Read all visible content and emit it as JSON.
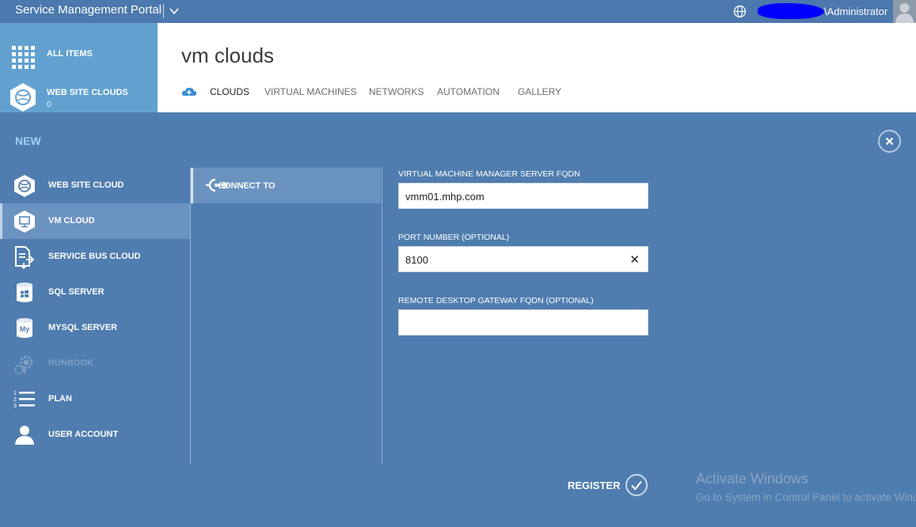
{
  "topbar": {
    "app_title": "Service Management Portal",
    "user": "\\Administrator",
    "icons": [
      "chevron-down-icon",
      "globe-icon",
      "avatar-icon"
    ]
  },
  "nav": {
    "items": [
      {
        "label": "ALL ITEMS",
        "icon": "grid-icon"
      },
      {
        "label": "WEB SITE CLOUDS",
        "count": "0",
        "icon": "web-site-cloud-icon"
      }
    ]
  },
  "header": {
    "title": "vm clouds",
    "tabs": [
      {
        "label": "CLOUDS",
        "active": true
      },
      {
        "label": "VIRTUAL MACHINES"
      },
      {
        "label": "NETWORKS"
      },
      {
        "label": "AUTOMATION"
      },
      {
        "label": "GALLERY"
      }
    ]
  },
  "drawer": {
    "title": "NEW",
    "categories": [
      {
        "label": "WEB SITE CLOUD",
        "icon": "web-site-cloud-icon"
      },
      {
        "label": "VM CLOUD",
        "icon": "monitor-icon",
        "selected": true
      },
      {
        "label": "SERVICE BUS CLOUD",
        "icon": "service-bus-icon"
      },
      {
        "label": "SQL SERVER",
        "icon": "sql-server-icon"
      },
      {
        "label": "MYSQL SERVER",
        "icon": "mysql-icon"
      },
      {
        "label": "RUNBOOK",
        "icon": "gear-icon",
        "disabled": true
      },
      {
        "label": "PLAN",
        "icon": "numbered-list-icon"
      },
      {
        "label": "USER ACCOUNT",
        "icon": "user-icon"
      }
    ],
    "step": {
      "label": "CONNECT TO",
      "icon": "plug-icon"
    },
    "fields": {
      "vmm_label": "VIRTUAL MACHINE MANAGER SERVER FQDN",
      "vmm_value": "vmm01.mhp.com",
      "port_label": "PORT NUMBER (OPTIONAL)",
      "port_value": "8100",
      "rdg_label": "REMOTE DESKTOP GATEWAY FQDN (OPTIONAL)",
      "rdg_value": ""
    },
    "register_label": "REGISTER"
  },
  "watermark": {
    "title": "Activate Windows",
    "subtitle": "Go to System in Control Panel to activate Windows."
  },
  "colors": {
    "topbar": "#4b78ad",
    "drawer": "#4f7daf",
    "nav_panel": "#62a1cf",
    "selected": "#6b93c0",
    "accent_title": "#9fd0f5"
  }
}
